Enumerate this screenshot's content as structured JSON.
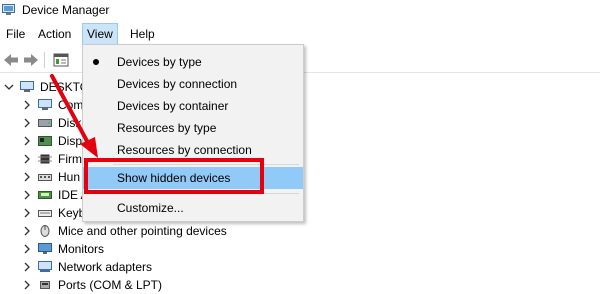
{
  "window": {
    "title": "Device Manager"
  },
  "menubar": {
    "file": "File",
    "action": "Action",
    "view": "View",
    "help": "Help"
  },
  "tree": {
    "root": "DESKTO",
    "items": [
      {
        "label": "Com",
        "icon": "computer-icon"
      },
      {
        "label": "Disk",
        "icon": "disk-drive-icon"
      },
      {
        "label": "Disp",
        "icon": "display-adapter-icon"
      },
      {
        "label": "Firm",
        "icon": "firmware-icon"
      },
      {
        "label": "Hun",
        "icon": "hid-icon"
      },
      {
        "label": "IDE A",
        "icon": "ide-controller-icon"
      },
      {
        "label": "Keyb",
        "icon": "keyboard-icon"
      },
      {
        "label": "Mice and other pointing devices",
        "icon": "mouse-icon"
      },
      {
        "label": "Monitors",
        "icon": "monitor-icon"
      },
      {
        "label": "Network adapters",
        "icon": "network-adapter-icon"
      },
      {
        "label": "Ports (COM & LPT)",
        "icon": "port-icon"
      }
    ]
  },
  "view_menu": {
    "items": [
      {
        "label": "Devices by type",
        "checked": true
      },
      {
        "label": "Devices by connection"
      },
      {
        "label": "Devices by container"
      },
      {
        "label": "Resources by type"
      },
      {
        "label": "Resources by connection"
      },
      {
        "label": "Show hidden devices",
        "highlighted": true
      },
      {
        "label": "Customize..."
      }
    ]
  },
  "colors": {
    "highlight": "#91c9f7",
    "annotation": "#e3000f",
    "menu_bg": "#f2f2f2"
  }
}
